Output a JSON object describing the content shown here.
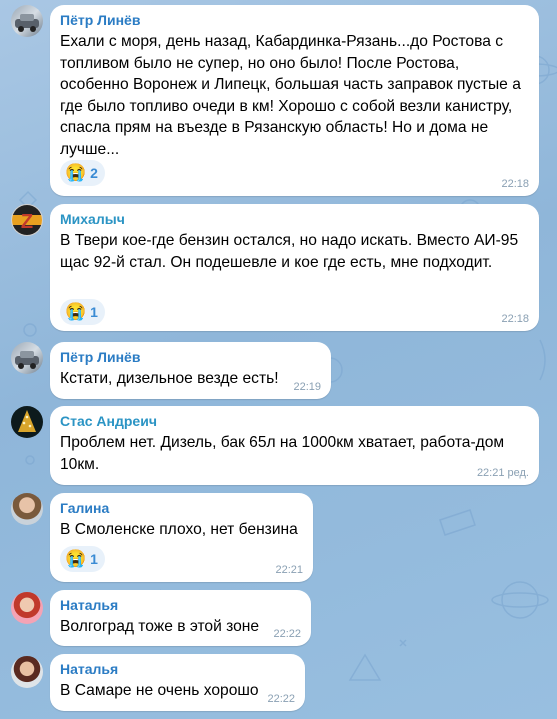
{
  "messages": [
    {
      "sender": "Пётр Линёв",
      "text": "Ехали с моря, день назад, Кабардинка-Рязань...до Ростова с топливом было не супер, но оно было! После Ростова, особенно Воронеж и Липецк, большая часть заправок пустые а где было топливо очеди в км! Хорошо с собой везли канистру, спасла прям на въезде в Рязанскую область! Но и дома не лучше...",
      "reaction": {
        "emoji": "😭",
        "count": "2"
      },
      "time": "22:18",
      "name_color": "#2b7cc4",
      "avatar": "photo-car"
    },
    {
      "sender": "Михалыч",
      "text": "В Твери кое-где бензин остался, но надо искать. Вместо АИ-95 щас 92-й стал. Он подешевле и кое где есть, мне подходит.",
      "reaction": {
        "emoji": "😭",
        "count": "1"
      },
      "time": "22:18",
      "name_color": "#2b94c4",
      "avatar": "z-flag"
    },
    {
      "sender": "Пётр Линёв",
      "text": "Кстати, дизельное везде есть!",
      "time": "22:19",
      "name_color": "#2b7cc4",
      "avatar": "photo-car"
    },
    {
      "sender": "Стас Андреич",
      "text": "Проблем нет. Дизель, бак 65л на 1000км хватает, работа-дом 10км.",
      "time": "22:21 ред.",
      "name_color": "#2b94c4",
      "avatar": "christmas-tree"
    },
    {
      "sender": "Галина",
      "text": "В Смоленске плохо, нет бензина",
      "reaction": {
        "emoji": "😭",
        "count": "1"
      },
      "time": "22:21",
      "name_color": "#2b7cc4",
      "avatar": "portrait"
    },
    {
      "sender": "Наталья",
      "text": "Волгоград тоже в этой зоне",
      "time": "22:22",
      "name_color": "#2b7cc4",
      "avatar": "portrait-pink"
    },
    {
      "sender": "Наталья",
      "text": "В Самаре не очень хорошо",
      "time": "22:22",
      "name_color": "#2b7cc4",
      "avatar": "portrait-dark"
    }
  ]
}
